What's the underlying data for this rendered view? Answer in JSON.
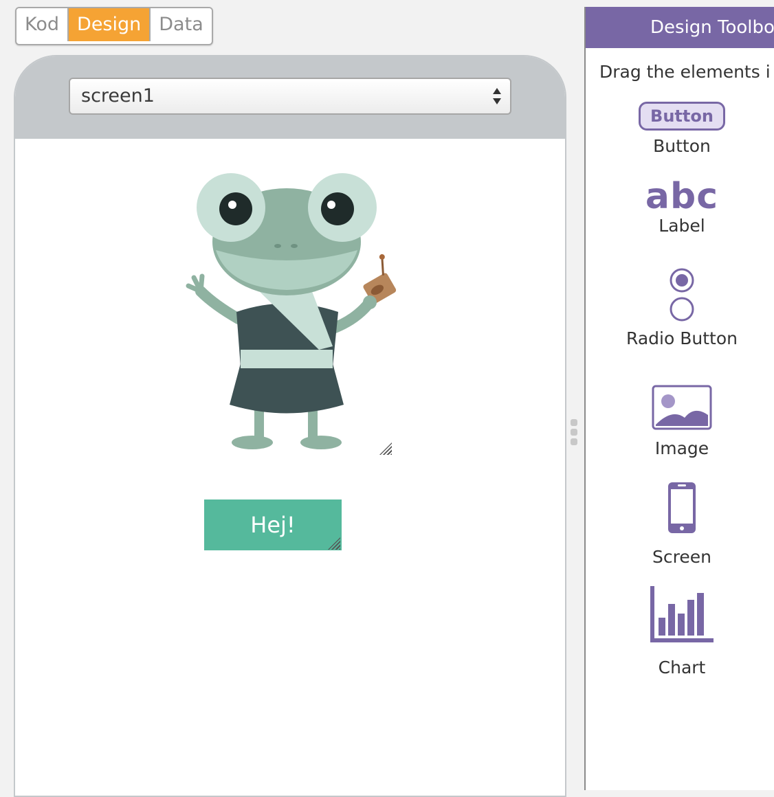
{
  "modes": {
    "kod": "Kod",
    "design": "Design",
    "data": "Data"
  },
  "screen_select": {
    "value": "screen1"
  },
  "canvas": {
    "button_text": "Hej!"
  },
  "toolbox": {
    "title": "Design Toolbo",
    "hint": "Drag the elements i",
    "items": [
      {
        "label": "Button",
        "icon": "button-icon",
        "icon_text": "Button"
      },
      {
        "label": "Label",
        "icon": "abc-label-icon",
        "icon_text": "abc"
      },
      {
        "label": "Radio Button",
        "icon": "radio-button-icon"
      },
      {
        "label": "Image",
        "icon": "image-icon"
      },
      {
        "label": "Screen",
        "icon": "phone-screen-icon"
      },
      {
        "label": "Chart",
        "icon": "bar-chart-icon"
      }
    ]
  },
  "colors": {
    "active_mode": "#f5a334",
    "toolbox_accent": "#7867a5",
    "app_button": "#55b99c",
    "phone_frame": "#c4c8cb"
  }
}
